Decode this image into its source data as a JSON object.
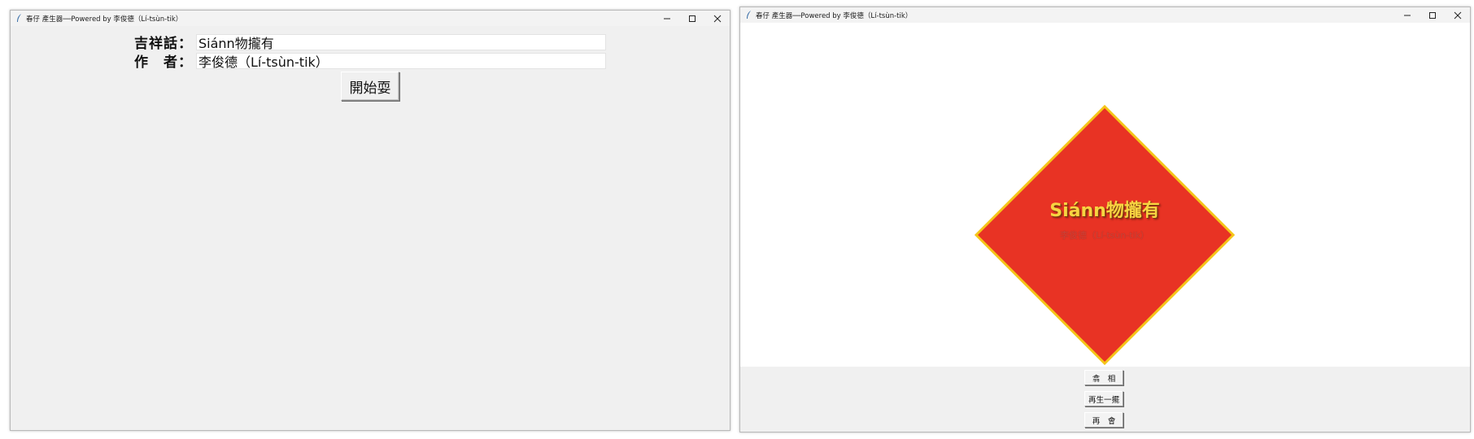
{
  "left_window": {
    "title": "春仔 產生器──Powered by 李俊德（Lí-tsùn-tik）",
    "controls": {
      "minimize": "–",
      "maximize": "☐",
      "close": "✕"
    },
    "form": {
      "phrase_label": "吉祥話：",
      "phrase_value": "Siánn物攏有",
      "author_label": "作　者：",
      "author_value": "李俊德（Lí-tsùn-tik）",
      "start_button": "開始耍"
    }
  },
  "right_window": {
    "title": "春仔 產生器──Powered by 李俊德（Lí-tsùn-tik）",
    "controls": {
      "minimize": "–",
      "maximize": "☐",
      "close": "✕"
    },
    "chunlian": {
      "text": "Siánn物攏有",
      "author": "李俊德（Lí-tsùn-tik）",
      "fill_color": "#e83324",
      "border_color": "#f5c518",
      "text_color": "#f7d441"
    },
    "buttons": {
      "save": "翕　相",
      "regenerate": "再生一擺",
      "goodbye": "再　會"
    }
  }
}
